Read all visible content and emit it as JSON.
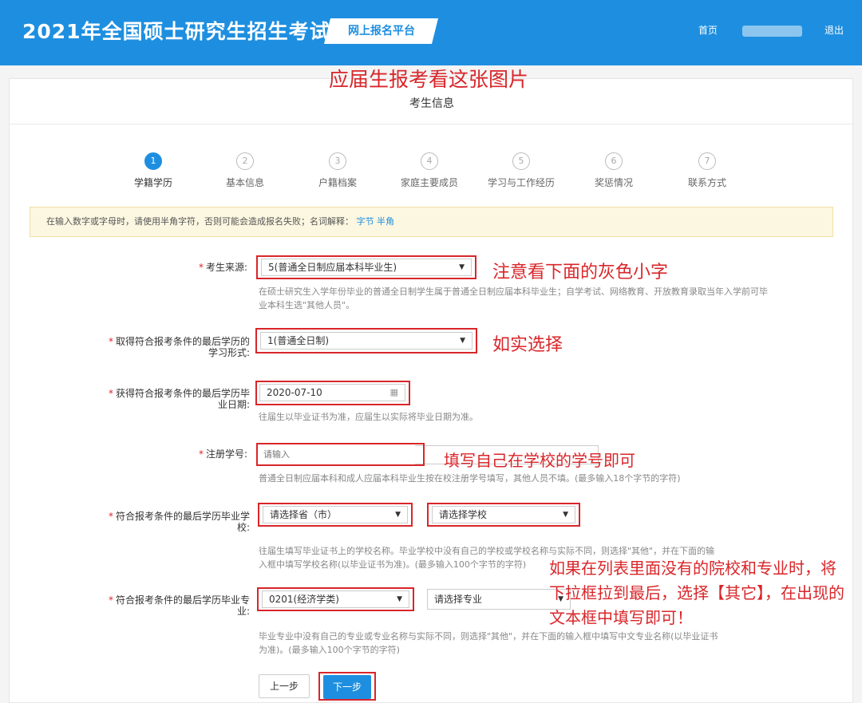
{
  "header": {
    "site_title": "2021年全国硕士研究生招生考试",
    "platform_label": "网上报名平台",
    "home_label": "首页",
    "logout_label": "退出"
  },
  "annotations": {
    "top": "应届生报考看这张图片",
    "source_note": "注意看下面的灰色小字",
    "form_note": "如实选择",
    "student_id_note": "填写自己在学校的学号即可",
    "school_major_note": "如果在列表里面没有的院校和专业时，将下拉框拉到最后，选择【其它】，在出现的文本框中填写即可！"
  },
  "card": {
    "title": "考生信息"
  },
  "steps": [
    {
      "num": "1",
      "label": "学籍学历",
      "active": true
    },
    {
      "num": "2",
      "label": "基本信息",
      "active": false
    },
    {
      "num": "3",
      "label": "户籍档案",
      "active": false
    },
    {
      "num": "4",
      "label": "家庭主要成员",
      "active": false
    },
    {
      "num": "5",
      "label": "学习与工作经历",
      "active": false
    },
    {
      "num": "6",
      "label": "奖惩情况",
      "active": false
    },
    {
      "num": "7",
      "label": "联系方式",
      "active": false
    }
  ],
  "notice": {
    "text": "在输入数字或字母时，请使用半角字符，否则可能会造成报名失败；名词解释：",
    "link_byte": "字节",
    "link_halfwidth": "半角"
  },
  "form": {
    "source": {
      "label": "考生来源:",
      "value": "5(普通全日制应届本科毕业生)",
      "hint": "在硕士研究生入学年份毕业的普通全日制学生属于普通全日制应届本科毕业生；自学考试、网络教育、开放教育录取当年入学前可毕业本科生选\"其他人员\"。"
    },
    "study_form": {
      "label_line1": "取得符合报考条件的最后学历的",
      "label_line2": "学习形式:",
      "value": "1(普通全日制)"
    },
    "grad_date": {
      "label_line1": "获得符合报考条件的最后学历毕",
      "label_line2": "业日期:",
      "value": "2020-07-10",
      "hint": "往届生以毕业证书为准，应届生以实际将毕业日期为准。"
    },
    "student_id": {
      "label": "注册学号:",
      "placeholder": "请输入",
      "hint": "普通全日制应届本科和成人应届本科毕业生按在校注册学号填写，其他人员不填。(最多输入18个字节的字符)"
    },
    "school": {
      "label_line1": "符合报考条件的最后学历毕业学",
      "label_line2": "校:",
      "province_value": "请选择省（市）",
      "school_value": "请选择学校",
      "hint_line1": "往届生填写毕业证书上的学校名称。毕业学校中没有自己的学校或学校名称与实际不同，则选择\"其他\"，并在下面的输",
      "hint_line2": "入框中填写学校名称(以毕业证书为准)。(最多输入100个字节的字符)"
    },
    "major": {
      "label_line1": "符合报考条件的最后学历毕业专",
      "label_line2": "业:",
      "category_value": "0201(经济学类)",
      "major_value": "请选择专业",
      "hint_line1": "毕业专业中没有自己的专业或专业名称与实际不同，则选择\"其他\"，并在下面的输入框中填写中文专业名称(以毕业证书",
      "hint_line2": "为准)。(最多输入100个字节的字符)"
    }
  },
  "buttons": {
    "prev": "上一步",
    "next": "下一步"
  },
  "colors": {
    "brand_blue": "#1e8fe0",
    "annotation_red": "#d9262a"
  }
}
